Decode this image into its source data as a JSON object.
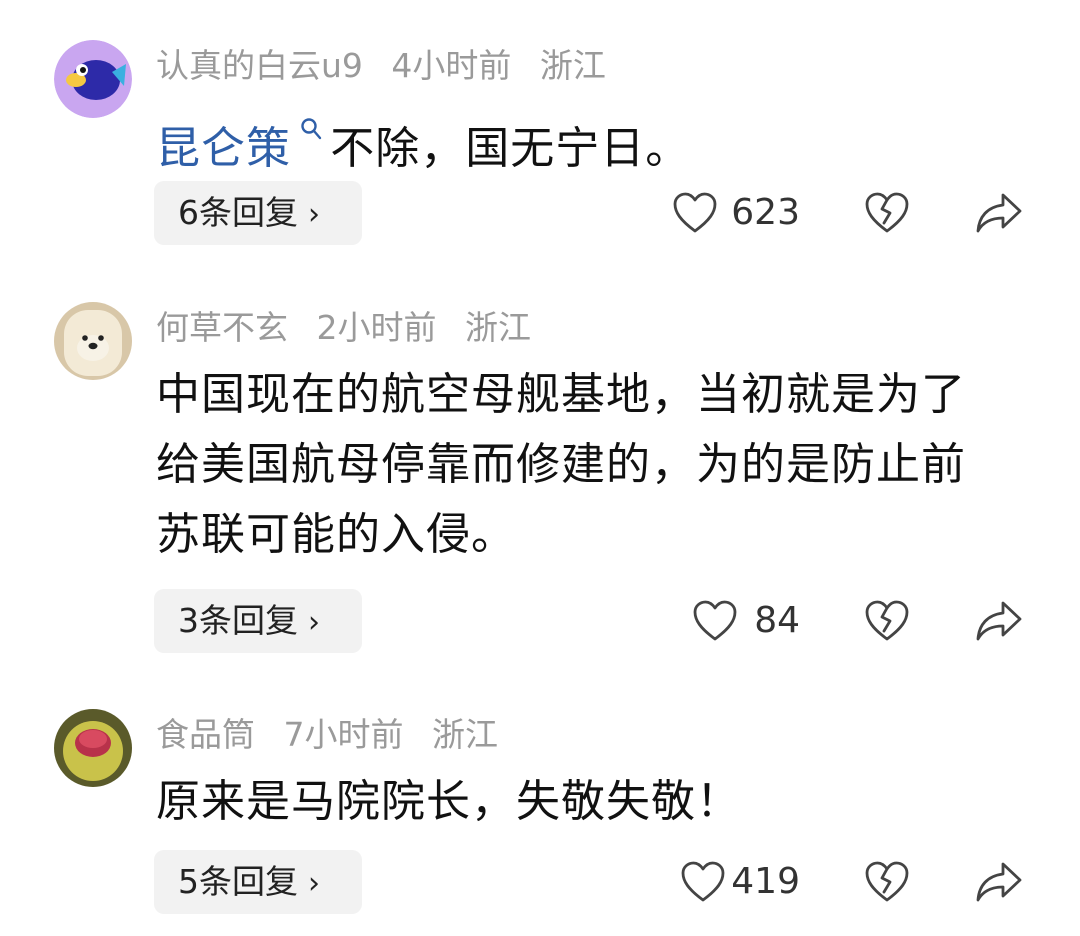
{
  "comments": [
    {
      "author": "认真的白云u9",
      "time": "4小时前",
      "location": "浙江",
      "topic": "昆仑策",
      "text": "不除，国无宁日。",
      "replies": "6条回复",
      "likes": "623"
    },
    {
      "author": "何草不玄",
      "time": "2小时前",
      "location": "浙江",
      "text": "中国现在的航空母舰基地，当初就是为了给美国航母停靠而修建的，为的是防止前苏联可能的入侵。",
      "replies": "3条回复",
      "likes": "84"
    },
    {
      "author": "食品筒",
      "time": "7小时前",
      "location": "浙江",
      "text": "原来是马院院长，失敬失敬！",
      "replies": "5条回复",
      "likes": "419"
    }
  ],
  "icons": {
    "chevron": "chevron-right-icon",
    "like": "heart-icon",
    "dislike": "broken-heart-icon",
    "share": "share-arrow-icon",
    "search": "search-icon"
  },
  "colors": {
    "meta": "#9a9a9a",
    "topic_link": "#2f5fa8",
    "reply_bg": "#f2f2f2"
  }
}
